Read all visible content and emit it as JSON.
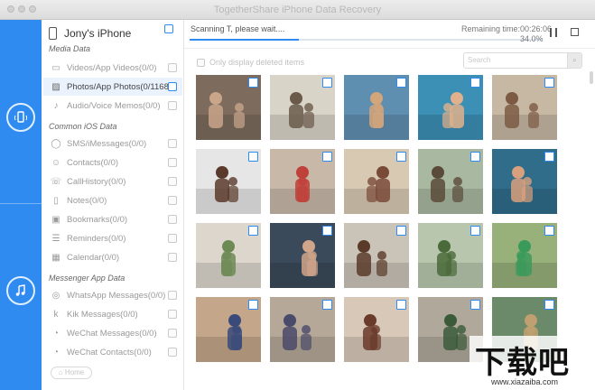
{
  "window": {
    "title": "TogetherShare iPhone Data Recovery"
  },
  "rail": {
    "items": [
      {
        "icon": "phone-recovery-icon"
      },
      {
        "icon": "music-recovery-icon"
      }
    ]
  },
  "sidebar": {
    "device_name": "Jony's iPhone",
    "sections": [
      {
        "label": "Media Data"
      },
      {
        "label": "Common iOS Data"
      },
      {
        "label": "Messenger App Data"
      }
    ],
    "items": [
      {
        "label": "Videos/App Videos(0/0)",
        "icon": "video-icon",
        "glyph": "▭"
      },
      {
        "label": "Photos/App Photos(0/11685)",
        "icon": "photo-icon",
        "glyph": "▨"
      },
      {
        "label": "Audio/Voice Memos(0/0)",
        "icon": "audio-icon",
        "glyph": "♪"
      },
      {
        "label": "SMS/iMessages(0/0)",
        "icon": "message-icon",
        "glyph": "◯"
      },
      {
        "label": "Contacts(0/0)",
        "icon": "contacts-icon",
        "glyph": "☺"
      },
      {
        "label": "CallHistory(0/0)",
        "icon": "phone-icon",
        "glyph": "☏"
      },
      {
        "label": "Notes(0/0)",
        "icon": "notes-icon",
        "glyph": "▯"
      },
      {
        "label": "Bookmarks(0/0)",
        "icon": "bookmark-icon",
        "glyph": "▣"
      },
      {
        "label": "Reminders(0/0)",
        "icon": "reminder-icon",
        "glyph": "☰"
      },
      {
        "label": "Calendar(0/0)",
        "icon": "calendar-icon",
        "glyph": "▦"
      },
      {
        "label": "WhatsApp Messages(0/0)",
        "icon": "whatsapp-icon",
        "glyph": "◎"
      },
      {
        "label": "Kik Messages(0/0)",
        "icon": "kik-icon",
        "glyph": "k"
      },
      {
        "label": "WeChat Messages(0/0)",
        "icon": "wechat-icon",
        "glyph": "◔"
      },
      {
        "label": "WeChat Contacts(0/0)",
        "icon": "wechat-contacts-icon",
        "glyph": "◔"
      }
    ],
    "home_label": "Home"
  },
  "scan": {
    "status": "Scanning T, please wait....",
    "remaining": "Remaining time:00:26:06",
    "percent_text": "34.0%",
    "progress": 0.31
  },
  "filter": {
    "only_deleted_label": "Only display deleted items"
  },
  "search": {
    "placeholder": "Search"
  },
  "photos": [
    {
      "bg": "#7d6b5e",
      "fg": "#c9a58a"
    },
    {
      "bg": "#d9d4c8",
      "fg": "#6a5a4a"
    },
    {
      "bg": "#5f8fb0",
      "fg": "#d2a57a"
    },
    {
      "bg": "#3c8fb5",
      "fg": "#e0b18c"
    },
    {
      "bg": "#c7b8a4",
      "fg": "#7c5a44"
    },
    {
      "bg": "#e6e6e6",
      "fg": "#5a3a2a"
    },
    {
      "bg": "#c8b8a8",
      "fg": "#c0403a"
    },
    {
      "bg": "#d8c9b2",
      "fg": "#7a4a38"
    },
    {
      "bg": "#a9b8a0",
      "fg": "#5a4a3a"
    },
    {
      "bg": "#2f6d8a",
      "fg": "#d8a07c"
    },
    {
      "bg": "#dcd6cc",
      "fg": "#6d8a55"
    },
    {
      "bg": "#3b4a5a",
      "fg": "#d0a58a"
    },
    {
      "bg": "#cac3b8",
      "fg": "#5a3b2a"
    },
    {
      "bg": "#b8c6ae",
      "fg": "#4a6a3a"
    },
    {
      "bg": "#98b07a",
      "fg": "#3a9a5a"
    },
    {
      "bg": "#c4a68a",
      "fg": "#3a4a7a"
    },
    {
      "bg": "#b5a898",
      "fg": "#4a4a6a"
    },
    {
      "bg": "#d8c8b8",
      "fg": "#6a3a2a"
    },
    {
      "bg": "#b0a89a",
      "fg": "#3a5a3a"
    },
    {
      "bg": "#6a8a6a",
      "fg": "#c0a070"
    }
  ],
  "watermark": {
    "big": "下载吧",
    "small": "www.xiazaiba.com"
  }
}
